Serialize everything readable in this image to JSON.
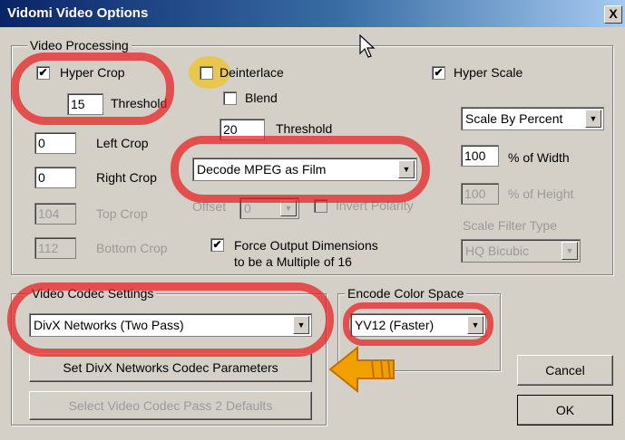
{
  "window": {
    "title": "Vidomi Video Options",
    "close_glyph": "X"
  },
  "video_processing": {
    "legend": "Video Processing",
    "hyper_crop": {
      "label": "Hyper Crop",
      "checked": true
    },
    "hyper_crop_threshold": {
      "value": "15",
      "label": "Threshold"
    },
    "deinterlace": {
      "label": "Deinterlace",
      "checked": false
    },
    "blend": {
      "label": "Blend",
      "checked": false
    },
    "deinterlace_threshold": {
      "value": "20",
      "label": "Threshold"
    },
    "hyper_scale": {
      "label": "Hyper Scale",
      "checked": true
    },
    "left_crop": {
      "value": "0",
      "label": "Left Crop"
    },
    "right_crop": {
      "value": "0",
      "label": "Right Crop"
    },
    "top_crop": {
      "value": "104",
      "label": "Top Crop"
    },
    "bottom_crop": {
      "value": "112",
      "label": "Bottom Crop"
    },
    "decode_mode": {
      "selected": "Decode MPEG as Film"
    },
    "offset": {
      "label": "Offset",
      "value": "0"
    },
    "invert_polarity": {
      "label": "Invert Polarity",
      "checked": false
    },
    "force_output": {
      "label_line1": "Force Output Dimensions",
      "label_line2": "to be a Multiple of 16",
      "checked": true
    },
    "scale_mode": {
      "selected": "Scale By Percent"
    },
    "width_percent": {
      "value": "100",
      "label": "% of Width"
    },
    "height_percent": {
      "value": "100",
      "label": "% of Height"
    },
    "scale_filter": {
      "label": "Scale Filter Type",
      "selected": "HQ Bicubic"
    }
  },
  "codec": {
    "legend": "Video Codec Settings",
    "selected": "DivX Networks (Two Pass)",
    "set_params_label": "Set DivX Networks Codec Parameters",
    "select_defaults_label": "Select Video Codec Pass 2 Defaults"
  },
  "color_space": {
    "legend": "Encode Color Space",
    "selected": "YV12 (Faster)"
  },
  "buttons": {
    "cancel": "Cancel",
    "ok": "OK"
  },
  "check_glyph": "✔",
  "annotation_colors": {
    "red_marker": "#e61e1e",
    "yellow_marker": "#f5c000",
    "orange_arrow": "#f0a000"
  }
}
